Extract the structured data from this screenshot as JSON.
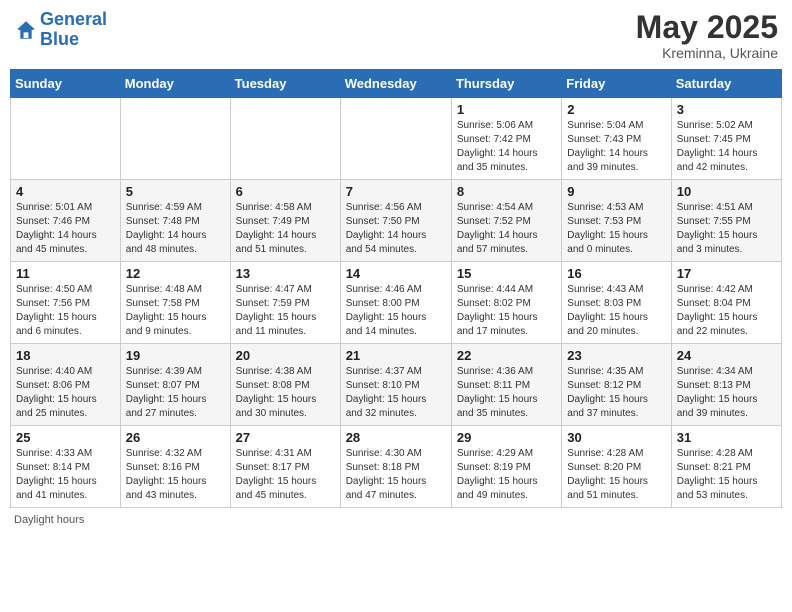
{
  "logo": {
    "text_general": "General",
    "text_blue": "Blue"
  },
  "title": {
    "month_year": "May 2025",
    "location": "Kreminna, Ukraine"
  },
  "days_of_week": [
    "Sunday",
    "Monday",
    "Tuesday",
    "Wednesday",
    "Thursday",
    "Friday",
    "Saturday"
  ],
  "footer": {
    "note": "Daylight hours"
  },
  "weeks": [
    [
      {
        "day": "",
        "info": ""
      },
      {
        "day": "",
        "info": ""
      },
      {
        "day": "",
        "info": ""
      },
      {
        "day": "",
        "info": ""
      },
      {
        "day": "1",
        "info": "Sunrise: 5:06 AM\nSunset: 7:42 PM\nDaylight: 14 hours\nand 35 minutes."
      },
      {
        "day": "2",
        "info": "Sunrise: 5:04 AM\nSunset: 7:43 PM\nDaylight: 14 hours\nand 39 minutes."
      },
      {
        "day": "3",
        "info": "Sunrise: 5:02 AM\nSunset: 7:45 PM\nDaylight: 14 hours\nand 42 minutes."
      }
    ],
    [
      {
        "day": "4",
        "info": "Sunrise: 5:01 AM\nSunset: 7:46 PM\nDaylight: 14 hours\nand 45 minutes."
      },
      {
        "day": "5",
        "info": "Sunrise: 4:59 AM\nSunset: 7:48 PM\nDaylight: 14 hours\nand 48 minutes."
      },
      {
        "day": "6",
        "info": "Sunrise: 4:58 AM\nSunset: 7:49 PM\nDaylight: 14 hours\nand 51 minutes."
      },
      {
        "day": "7",
        "info": "Sunrise: 4:56 AM\nSunset: 7:50 PM\nDaylight: 14 hours\nand 54 minutes."
      },
      {
        "day": "8",
        "info": "Sunrise: 4:54 AM\nSunset: 7:52 PM\nDaylight: 14 hours\nand 57 minutes."
      },
      {
        "day": "9",
        "info": "Sunrise: 4:53 AM\nSunset: 7:53 PM\nDaylight: 15 hours\nand 0 minutes."
      },
      {
        "day": "10",
        "info": "Sunrise: 4:51 AM\nSunset: 7:55 PM\nDaylight: 15 hours\nand 3 minutes."
      }
    ],
    [
      {
        "day": "11",
        "info": "Sunrise: 4:50 AM\nSunset: 7:56 PM\nDaylight: 15 hours\nand 6 minutes."
      },
      {
        "day": "12",
        "info": "Sunrise: 4:48 AM\nSunset: 7:58 PM\nDaylight: 15 hours\nand 9 minutes."
      },
      {
        "day": "13",
        "info": "Sunrise: 4:47 AM\nSunset: 7:59 PM\nDaylight: 15 hours\nand 11 minutes."
      },
      {
        "day": "14",
        "info": "Sunrise: 4:46 AM\nSunset: 8:00 PM\nDaylight: 15 hours\nand 14 minutes."
      },
      {
        "day": "15",
        "info": "Sunrise: 4:44 AM\nSunset: 8:02 PM\nDaylight: 15 hours\nand 17 minutes."
      },
      {
        "day": "16",
        "info": "Sunrise: 4:43 AM\nSunset: 8:03 PM\nDaylight: 15 hours\nand 20 minutes."
      },
      {
        "day": "17",
        "info": "Sunrise: 4:42 AM\nSunset: 8:04 PM\nDaylight: 15 hours\nand 22 minutes."
      }
    ],
    [
      {
        "day": "18",
        "info": "Sunrise: 4:40 AM\nSunset: 8:06 PM\nDaylight: 15 hours\nand 25 minutes."
      },
      {
        "day": "19",
        "info": "Sunrise: 4:39 AM\nSunset: 8:07 PM\nDaylight: 15 hours\nand 27 minutes."
      },
      {
        "day": "20",
        "info": "Sunrise: 4:38 AM\nSunset: 8:08 PM\nDaylight: 15 hours\nand 30 minutes."
      },
      {
        "day": "21",
        "info": "Sunrise: 4:37 AM\nSunset: 8:10 PM\nDaylight: 15 hours\nand 32 minutes."
      },
      {
        "day": "22",
        "info": "Sunrise: 4:36 AM\nSunset: 8:11 PM\nDaylight: 15 hours\nand 35 minutes."
      },
      {
        "day": "23",
        "info": "Sunrise: 4:35 AM\nSunset: 8:12 PM\nDaylight: 15 hours\nand 37 minutes."
      },
      {
        "day": "24",
        "info": "Sunrise: 4:34 AM\nSunset: 8:13 PM\nDaylight: 15 hours\nand 39 minutes."
      }
    ],
    [
      {
        "day": "25",
        "info": "Sunrise: 4:33 AM\nSunset: 8:14 PM\nDaylight: 15 hours\nand 41 minutes."
      },
      {
        "day": "26",
        "info": "Sunrise: 4:32 AM\nSunset: 8:16 PM\nDaylight: 15 hours\nand 43 minutes."
      },
      {
        "day": "27",
        "info": "Sunrise: 4:31 AM\nSunset: 8:17 PM\nDaylight: 15 hours\nand 45 minutes."
      },
      {
        "day": "28",
        "info": "Sunrise: 4:30 AM\nSunset: 8:18 PM\nDaylight: 15 hours\nand 47 minutes."
      },
      {
        "day": "29",
        "info": "Sunrise: 4:29 AM\nSunset: 8:19 PM\nDaylight: 15 hours\nand 49 minutes."
      },
      {
        "day": "30",
        "info": "Sunrise: 4:28 AM\nSunset: 8:20 PM\nDaylight: 15 hours\nand 51 minutes."
      },
      {
        "day": "31",
        "info": "Sunrise: 4:28 AM\nSunset: 8:21 PM\nDaylight: 15 hours\nand 53 minutes."
      }
    ]
  ]
}
